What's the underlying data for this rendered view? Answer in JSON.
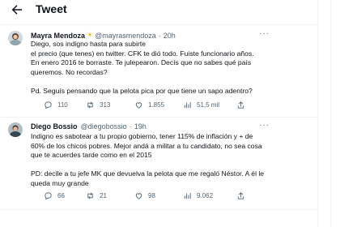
{
  "header": {
    "title": "Tweet"
  },
  "tweets": [
    {
      "name": "Mayra Mendoza",
      "handle": "@mayrasmendoza",
      "separator": "·",
      "time": "20h",
      "more": "···",
      "lines": [
        "Diego, sos indigno hasta para subirte",
        "el precio (que tenes) en twitter. CFK te dió todo. Fuiste funcionario años.",
        "En enero 2016 te borraste. Te julepearon. Decís que no sabes qué país",
        "queremos. No recordas?",
        "",
        "Pd. Seguís pensando que la pelota pica por que tiene un sapo adentro?"
      ],
      "actions": {
        "replies": "110",
        "retweets": "313",
        "likes": "1.855",
        "views": "51,5 mil"
      }
    },
    {
      "name": "Diego Bossio",
      "handle": "@diegobossio",
      "separator": "·",
      "time": "19h",
      "more": "···",
      "lines": [
        "Indigno es sabotear a tu propio gobierno, tener 115% de inflación y + de",
        "60% de los chicos pobres. Mejor andá a militar a tu candidato, no sea cosa",
        "que te acuerdes tarde como en el 2015",
        "",
        "PD: decile a tu jefe MK que devuelva la pelota que me regaló Néstor. A él le",
        "queda muy grande"
      ],
      "actions": {
        "replies": "66",
        "retweets": "21",
        "likes": "98",
        "views": "9.062"
      }
    }
  ],
  "colors": {
    "text": "#0f1419",
    "muted": "#536471",
    "divider": "#eff3f4",
    "sun": "#f4b400"
  }
}
